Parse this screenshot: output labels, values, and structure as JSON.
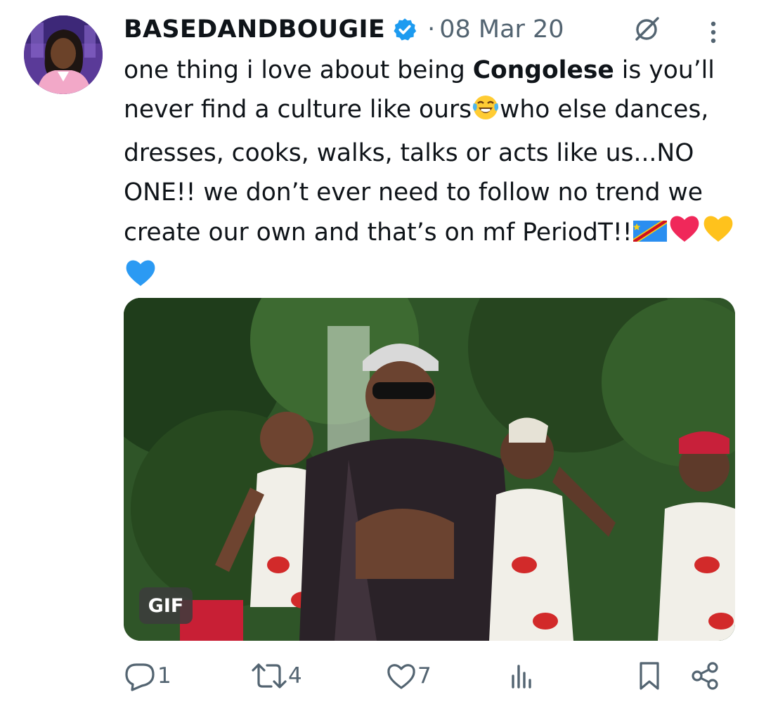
{
  "tweet": {
    "author_name": "BASEDANDBOUGIE",
    "separator": "·",
    "date": "08 Mar 20",
    "text_part1": "one thing i love about being ",
    "text_bold": "Congolese",
    "text_part2": " is you’ll never find a culture like ours",
    "text_part3": "who else dances, dresses, cooks, walks, talks or acts like us...NO ONE!! we don’t ever need to follow no trend we create our own and that’s on mf PeriodT!!"
  },
  "media": {
    "badge": "GIF"
  },
  "actions": {
    "reply_count": "1",
    "retweet_count": "4",
    "like_count": "7"
  },
  "colors": {
    "text": "#0f1419",
    "secondary": "#536471",
    "verified": "#1d9bf0"
  }
}
